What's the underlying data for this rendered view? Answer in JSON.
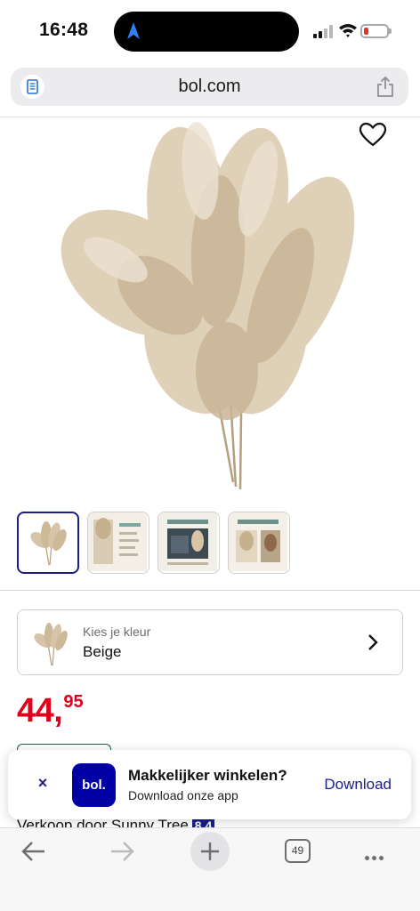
{
  "status_bar": {
    "time": "16:48",
    "icons": [
      "location-arrow-icon",
      "signal-icon",
      "wifi-icon",
      "battery-low-icon"
    ]
  },
  "browser": {
    "url": "bol.com",
    "icons": [
      "reader-icon",
      "share-icon"
    ]
  },
  "product": {
    "image_subject": "dried pampas grass bouquet",
    "thumbnail_count": 4,
    "selected_thumbnail": 1
  },
  "color_selector": {
    "label": "Kies je kleur",
    "value": "Beige"
  },
  "price": {
    "whole": "44,",
    "decimals": "95",
    "color": "#e0001b"
  },
  "seller": {
    "text": "Verkoop door Sunny Tree",
    "score": "8,4"
  },
  "app_banner": {
    "logo_text": "bol.",
    "title": "Makkelijker winkelen?",
    "subtitle": "Download onze app",
    "download_label": "Download",
    "close_label": "×"
  },
  "toolbar": {
    "tab_count": "49"
  },
  "colors": {
    "brand_blue": "#1a1e86",
    "logo_blue": "#0000a4",
    "price_red": "#e0001b"
  }
}
